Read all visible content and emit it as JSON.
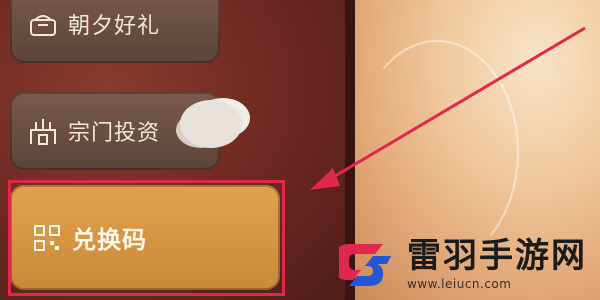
{
  "menu": {
    "items": [
      {
        "label": "朝夕好礼",
        "icon": "gift-icon"
      },
      {
        "label": "宗门投资",
        "icon": "tower-icon"
      },
      {
        "label": "兑换码",
        "icon": "qr-code-icon",
        "highlighted": true
      }
    ]
  },
  "annotation": {
    "highlight_color": "#e0284c"
  },
  "watermark": {
    "title": "雷羽手游网",
    "url": "www.leiucn.com"
  },
  "colors": {
    "panel": "#6a2720",
    "button": "#6b4e41",
    "active_button": "#d8963f"
  }
}
